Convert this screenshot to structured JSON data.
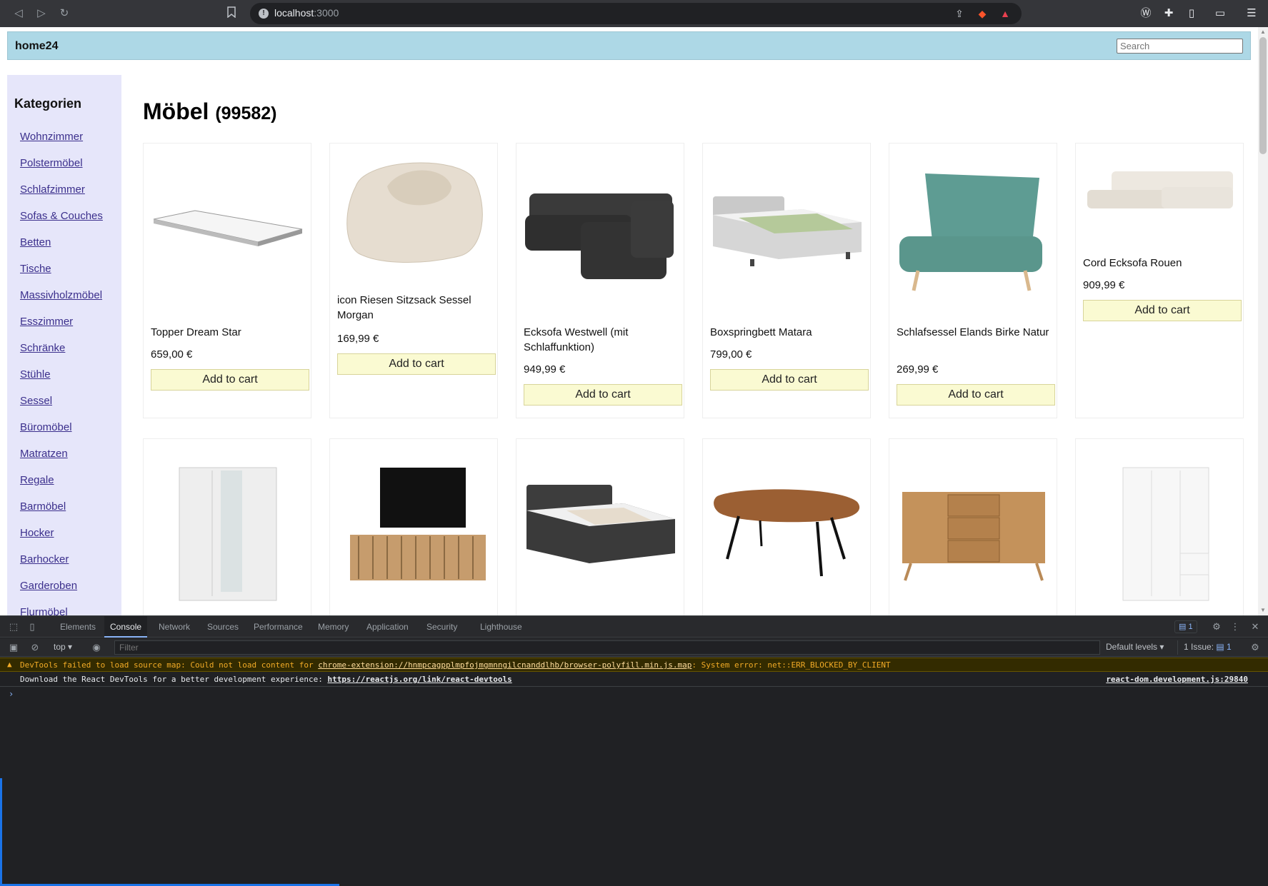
{
  "browser": {
    "url_host": "localhost",
    "url_port": ":3000"
  },
  "header": {
    "brand": "home24",
    "search_placeholder": "Search"
  },
  "sidebar": {
    "title": "Kategorien",
    "items": [
      "Wohnzimmer",
      "Polstermöbel",
      "Schlafzimmer",
      "Sofas & Couches",
      "Betten",
      "Tische",
      "Massivholzmöbel",
      "Esszimmer",
      "Schränke",
      "Stühle",
      "Sessel",
      "Büromöbel",
      "Matratzen",
      "Regale",
      "Barmöbel",
      "Hocker",
      "Barhocker",
      "Garderoben",
      "Flurmöbel"
    ]
  },
  "main": {
    "title": "Möbel",
    "count": "(99582)",
    "products": [
      {
        "name": "Topper Dream Star",
        "price": "659,00 €",
        "button": "Add to cart",
        "icon": "mattress-topper-image"
      },
      {
        "name": "icon Riesen Sitzsack Sessel Morgan",
        "price": "169,99 €",
        "button": "Add to cart",
        "icon": "beanbag-image"
      },
      {
        "name": "Ecksofa Westwell (mit Schlaffunktion)",
        "price": "949,99 €",
        "button": "Add to cart",
        "icon": "corner-sofa-image"
      },
      {
        "name": "Boxspringbett Matara",
        "price": "799,00 €",
        "button": "Add to cart",
        "icon": "boxspring-bed-image"
      },
      {
        "name": "Schlafsessel Elands Birke Natur",
        "price": "269,99 €",
        "button": "Add to cart",
        "icon": "armchair-image"
      },
      {
        "name": "Cord Ecksofa Rouen",
        "price": "909,99 €",
        "button": "Add to cart",
        "icon": "cord-sofa-image"
      }
    ],
    "second_row_icons": [
      "wardrobe-mirror-image",
      "tv-board-image",
      "boxspring-bed-dark-image",
      "table-image",
      "sideboard-image",
      "wardrobe-white-image"
    ]
  },
  "devtools": {
    "tabs": [
      "Elements",
      "Console",
      "Network",
      "Sources",
      "Performance",
      "Memory",
      "Application",
      "Security",
      "Lighthouse"
    ],
    "active_tab": "Console",
    "issue_badge": "1",
    "context": "top",
    "filter_placeholder": "Filter",
    "levels": "Default levels",
    "issues_text": "1 Issue:",
    "issues_count": "1",
    "warn_prefix": "DevTools failed to load source map: Could not load content for ",
    "warn_link": "chrome-extension://hnmpcagpplmpfojmgmnngilcnanddlhb/browser-polyfill.min.js.map",
    "warn_suffix": ": System error: net::ERR_BLOCKED_BY_CLIENT",
    "info_prefix": "Download the React DevTools for a better development experience: ",
    "info_link": "https://reactjs.org/link/react-devtools",
    "info_source": "react-dom.development.js:29840",
    "prompt": "›"
  }
}
